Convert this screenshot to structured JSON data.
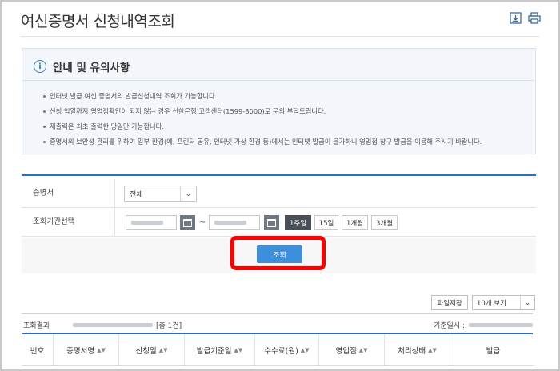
{
  "page": {
    "title": "여신증명서 신청내역조회",
    "icons": [
      "download-icon",
      "print-icon"
    ]
  },
  "notice": {
    "title": "안내 및 유의사항",
    "items": [
      "인터넷 발급 여신 증명서의 발급신청내역 조회가 가능합니다.",
      "신청 익일까지 영업점확인이 되지 않는 경우 신한은행 고객센터(1599-8000)로 문의 부탁드립니다.",
      "재출력은 최초 출력한 당일만 가능합니다.",
      "증명서의 보안성 관리를 위하여 일부 환경(예, 프린터 공유, 인터넷 가상 환경 등)에서는 인터넷 발급이 불가하니 영업점 창구 발급을 이용해 주시기 바랍니다."
    ]
  },
  "search": {
    "certificate_label": "증명서",
    "certificate_value": "전체",
    "period_label": "조회기간선택",
    "separator": "~",
    "periods": [
      "1주일",
      "15일",
      "1개월",
      "3개월"
    ],
    "active_period": "1주일",
    "search_button": "조회"
  },
  "toolbar": {
    "export_label": "파일저장",
    "page_size_value": "10개 보기"
  },
  "result": {
    "label": "조회결과",
    "count": "[총 1건]",
    "base_time_label": "기준일시 :"
  },
  "table": {
    "columns": [
      "번호",
      "증명서명",
      "신청일",
      "발급기준일",
      "수수료(원)",
      "영업점",
      "처리상태",
      "발급"
    ],
    "sortable": [
      false,
      true,
      true,
      true,
      true,
      true,
      true,
      false
    ]
  },
  "colors": {
    "accent": "#2f6fb6",
    "search_button": "#3d8fdc",
    "highlight": "#ff0000",
    "active_period": "#4a4f57"
  }
}
